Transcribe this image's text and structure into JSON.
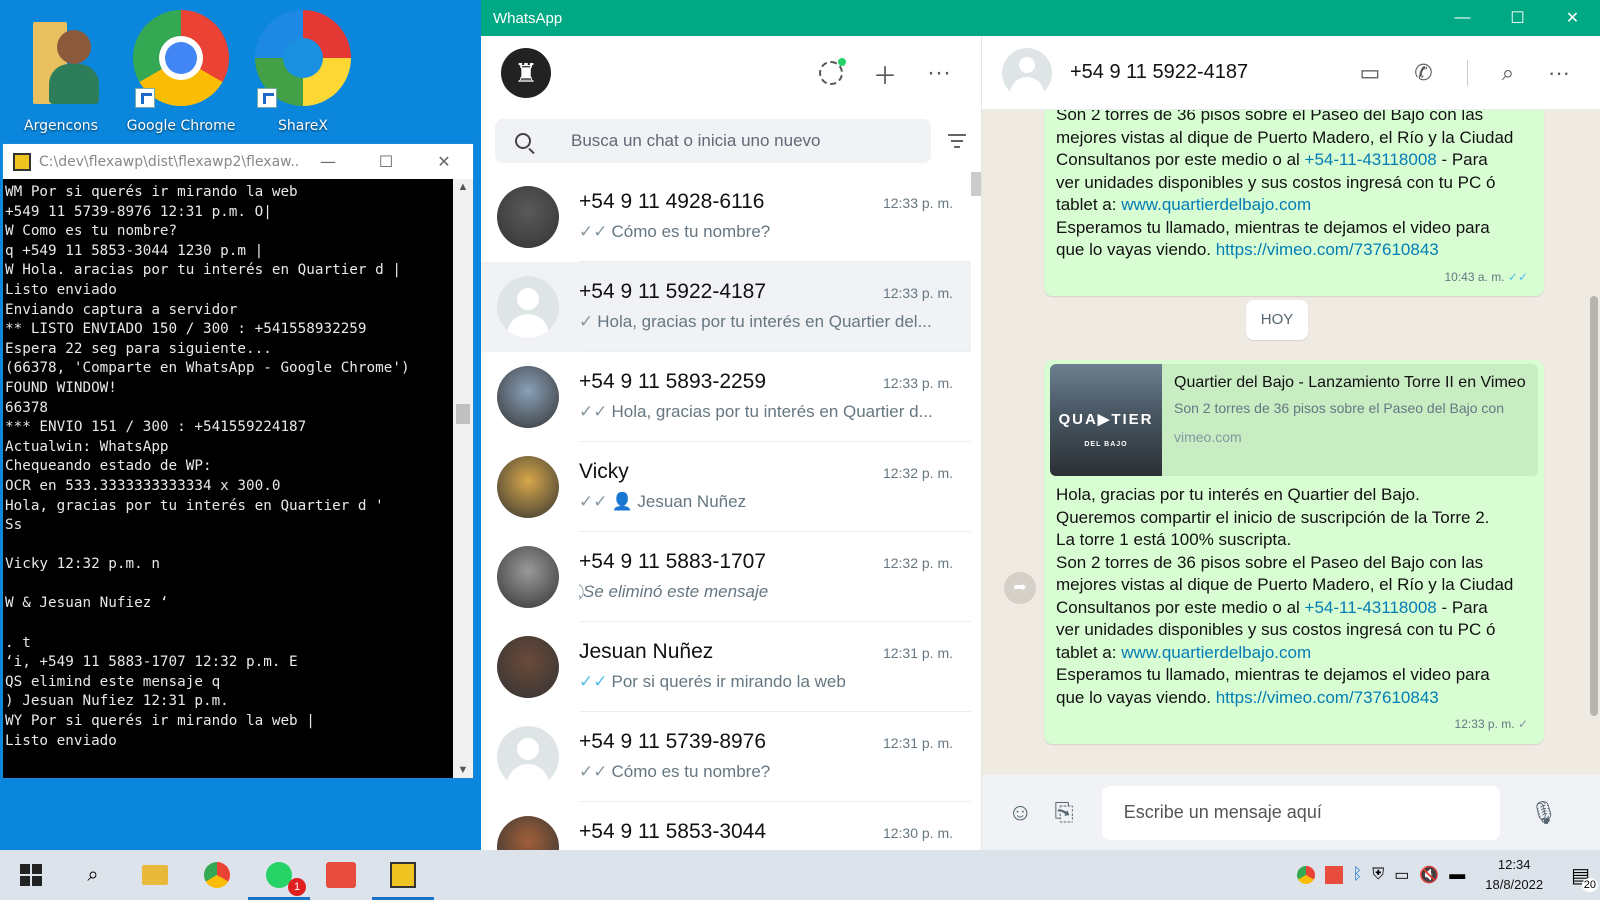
{
  "desktop": {
    "icons": [
      {
        "label": "Argencons",
        "icon": "folder-user-icon"
      },
      {
        "label": "Google Chrome",
        "icon": "chrome-icon"
      },
      {
        "label": "ShareX",
        "icon": "sharex-icon"
      }
    ]
  },
  "console": {
    "title": "C:\\dev\\flexawp\\dist\\flexawp2\\flexaw...",
    "lines": [
      "WM Por si querés ir mirando la web",
      "+549 11 5739-8976 12:31 p.m. O|",
      "W Como es tu nombre?",
      "q +549 11 5853-3044 1230 p.m |",
      "W Hola. aracias por tu interés en Quartier d |",
      "Listo enviado",
      "Enviando captura a servidor",
      "** LISTO ENVIADO 150 / 300 : +541558932259",
      "Espera 22 seg para siguiente...",
      "(66378, 'Comparte en WhatsApp - Google Chrome')",
      "FOUND WINDOW!",
      "66378",
      "*** ENVIO 151 / 300 : +541559224187",
      "Actualwin: WhatsApp",
      "Chequeando estado de WP:",
      "OCR en 533.3333333333334 x 300.0",
      "Hola, gracias por tu interés en Quartier d '",
      "Ss",
      "",
      "Vicky 12:32 p.m. n",
      "",
      "W & Jesuan Nufiez ‘",
      "",
      ". t",
      "‘i, +549 11 5883-1707 12:32 p.m. E",
      "QS elimind este mensaje q",
      ") Jesuan Nufiez 12:31 p.m.",
      "WY Por si querés ir mirando la web |",
      "Listo enviado"
    ]
  },
  "whatsapp": {
    "window_title": "WhatsApp",
    "search_placeholder": "Busca un chat o inicia uno nuevo",
    "chats": [
      {
        "name": "+54 9 11 4928-6116",
        "time": "12:33 p. m.",
        "tick": "✓✓",
        "tick_color": "grey",
        "msg": "Cómo es tu nombre?",
        "avatar": "photo",
        "avatar_color": "#5a5a5a"
      },
      {
        "name": "+54 9 11 5922-4187",
        "time": "12:33 p. m.",
        "tick": "✓",
        "tick_color": "grey",
        "msg": "Hola, gracias por tu interés en Quartier del...",
        "avatar": "default"
      },
      {
        "name": "+54 9 11 5893-2259",
        "time": "12:33 p. m.",
        "tick": "✓✓",
        "tick_color": "grey",
        "msg": "Hola, gracias por tu interés en Quartier d...",
        "avatar": "photo",
        "avatar_color": "#8aa0b8"
      },
      {
        "name": "Vicky",
        "time": "12:32 p. m.",
        "tick": "✓✓",
        "tick_color": "grey",
        "msg": "👤 Jesuan Nuñez",
        "avatar": "photo",
        "avatar_color": "#d8a84a"
      },
      {
        "name": "+54 9 11 5883-1707",
        "time": "12:32 p. m.",
        "tick": "⃠",
        "tick_color": "grey",
        "msg": "Se eliminó este mensaje",
        "avatar": "photo",
        "avatar_color": "#9a9a9a"
      },
      {
        "name": "Jesuan Nuñez",
        "time": "12:31 p. m.",
        "tick": "✓✓",
        "tick_color": "blue",
        "msg": "Por si querés ir mirando la web",
        "avatar": "photo",
        "avatar_color": "#6b4a3a"
      },
      {
        "name": "+54 9 11 5739-8976",
        "time": "12:31 p. m.",
        "tick": "✓✓",
        "tick_color": "grey",
        "msg": "Cómo es tu nombre?",
        "avatar": "default"
      },
      {
        "name": "+54 9 11 5853-3044",
        "time": "12:30 p. m.",
        "tick": "",
        "tick_color": "grey",
        "msg": "",
        "avatar": "photo",
        "avatar_color": "#a0603a"
      }
    ],
    "conversation": {
      "contact": "+54 9 11 5922-4187",
      "day_label": "HOY",
      "old_message": {
        "line1": "Son 2 torres de 36 pisos sobre el Paseo del Bajo con las",
        "line2": "mejores vistas al dique de Puerto Madero, el Río y la Ciudad",
        "line3_pre": "Consultanos por este medio o al ",
        "phone": "+54-11-43118008",
        "line3_post": " - Para",
        "line4": "ver unidades disponibles y sus costos ingresá con tu PC ó",
        "line5_pre": "tablet a: ",
        "site": "www.quartierdelbajo.com",
        "line6": "Esperamos tu llamado, mientras te dejamos el video para",
        "line7_pre": "que lo vayas viendo. ",
        "video": "https://vimeo.com/737610843",
        "time": "10:43 a. m."
      },
      "new_message": {
        "preview_title": "Quartier del Bajo - Lanzamiento Torre II en Vimeo",
        "preview_desc": "Son 2 torres de 36 pisos sobre el Paseo del Bajo con",
        "preview_domain": "vimeo.com",
        "thumb_text": "QUA▶TIER",
        "thumb_sub": "DEL BAJO",
        "p1": "Hola, gracias por tu interés en Quartier del Bajo.",
        "p2": "Queremos compartir el inicio de suscripción de la Torre 2.",
        "p3": "La torre 1 está 100% suscripta.",
        "line1": "Son 2 torres de 36 pisos sobre el Paseo del Bajo con las",
        "line2": "mejores vistas al dique de Puerto Madero, el Río y la Ciudad",
        "line3_pre": "Consultanos por este medio o al ",
        "phone": "+54-11-43118008",
        "line3_post": " - Para",
        "line4": "ver unidades disponibles y sus costos ingresá con tu PC ó",
        "line5_pre": "tablet a: ",
        "site": "www.quartierdelbajo.com",
        "line6": "Esperamos tu llamado, mientras te dejamos el video para",
        "line7_pre": "que lo vayas viendo. ",
        "video": "https://vimeo.com/737610843",
        "time": "12:33 p. m."
      },
      "input_placeholder": "Escribe un mensaje aquí"
    }
  },
  "taskbar": {
    "time": "12:34",
    "date": "18/8/2022",
    "whatsapp_badge": "1",
    "notifications": "20"
  }
}
